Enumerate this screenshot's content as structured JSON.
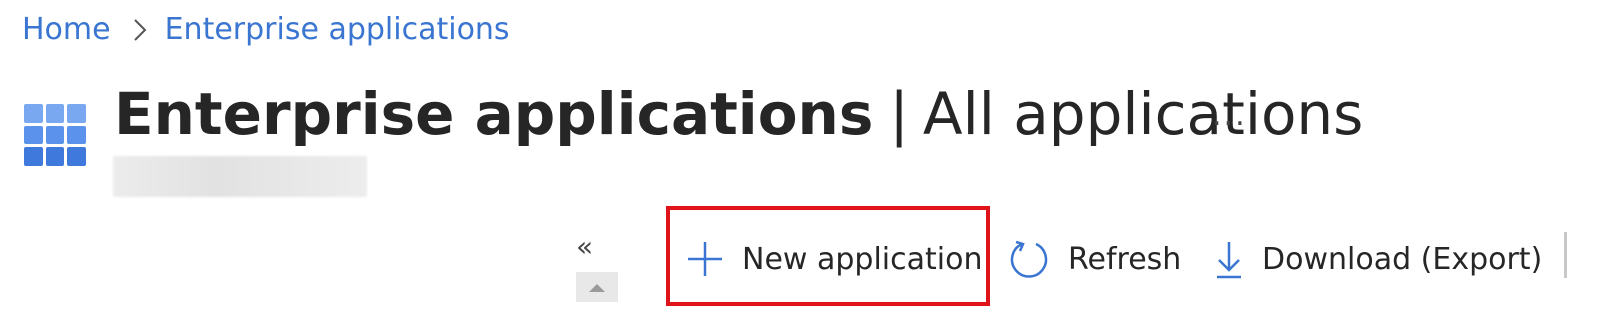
{
  "breadcrumb": {
    "items": [
      {
        "label": "Home"
      },
      {
        "label": "Enterprise applications"
      }
    ]
  },
  "header": {
    "icon": "app-grid-icon",
    "title_main": "Enterprise applications",
    "title_divider": "|",
    "title_sub": "All applications",
    "more_label": "..."
  },
  "toolbar": {
    "collapse_label": "«",
    "new_application": {
      "label": "New application",
      "icon": "plus-icon",
      "highlighted": true,
      "highlight_color": "#e0121a"
    },
    "refresh": {
      "label": "Refresh",
      "icon": "refresh-icon"
    },
    "download": {
      "label": "Download (Export)",
      "icon": "download-icon"
    }
  },
  "colors": {
    "accent": "#3a76d1",
    "text": "#262626",
    "highlight": "#e0121a"
  }
}
